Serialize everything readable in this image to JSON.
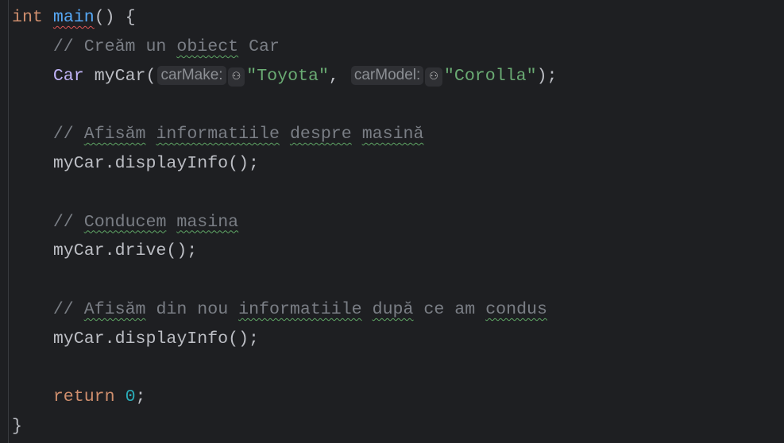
{
  "editor": {
    "lines": [
      [
        {
          "t": "int",
          "c": "kw"
        },
        {
          "t": " "
        },
        {
          "t": "main",
          "c": "fn err"
        },
        {
          "t": "() {"
        }
      ],
      [
        {
          "t": "    "
        },
        {
          "t": "// Creăm un ",
          "c": "cmt"
        },
        {
          "t": "obiect",
          "c": "cmt typo"
        },
        {
          "t": " Car",
          "c": "cmt"
        }
      ],
      [
        {
          "t": "    "
        },
        {
          "t": "Car",
          "c": "cls"
        },
        {
          "t": " myCar("
        },
        {
          "t": "carMake:",
          "c": "hint"
        },
        {
          "t": "⚇",
          "c": "hint-icon"
        },
        {
          "t": "\"Toyota\"",
          "c": "str"
        },
        {
          "t": ", "
        },
        {
          "t": "carModel:",
          "c": "hint"
        },
        {
          "t": "⚇",
          "c": "hint-icon"
        },
        {
          "t": "\"Corolla\"",
          "c": "str"
        },
        {
          "t": ");"
        }
      ],
      [
        {
          "t": ""
        }
      ],
      [
        {
          "t": "    "
        },
        {
          "t": "// ",
          "c": "cmt"
        },
        {
          "t": "Afisăm",
          "c": "cmt typo"
        },
        {
          "t": " ",
          "c": "cmt"
        },
        {
          "t": "informatiile",
          "c": "cmt typo"
        },
        {
          "t": " ",
          "c": "cmt"
        },
        {
          "t": "despre",
          "c": "cmt typo"
        },
        {
          "t": " ",
          "c": "cmt"
        },
        {
          "t": "masină",
          "c": "cmt typo"
        }
      ],
      [
        {
          "t": "    myCar.displayInfo();"
        }
      ],
      [
        {
          "t": ""
        }
      ],
      [
        {
          "t": "    "
        },
        {
          "t": "// ",
          "c": "cmt"
        },
        {
          "t": "Conducem",
          "c": "cmt typo"
        },
        {
          "t": " ",
          "c": "cmt"
        },
        {
          "t": "masina",
          "c": "cmt typo"
        }
      ],
      [
        {
          "t": "    myCar.drive();"
        }
      ],
      [
        {
          "t": ""
        }
      ],
      [
        {
          "t": "    "
        },
        {
          "t": "// ",
          "c": "cmt"
        },
        {
          "t": "Afisăm",
          "c": "cmt typo"
        },
        {
          "t": " din nou ",
          "c": "cmt"
        },
        {
          "t": "informatiile",
          "c": "cmt typo"
        },
        {
          "t": " ",
          "c": "cmt"
        },
        {
          "t": "după",
          "c": "cmt typo"
        },
        {
          "t": " ce am ",
          "c": "cmt"
        },
        {
          "t": "condus",
          "c": "cmt typo"
        }
      ],
      [
        {
          "t": "    myCar.displayInfo();"
        }
      ],
      [
        {
          "t": ""
        }
      ],
      [
        {
          "t": "    "
        },
        {
          "t": "return",
          "c": "kw"
        },
        {
          "t": " "
        },
        {
          "t": "0",
          "c": "num"
        },
        {
          "t": ";"
        }
      ],
      [
        {
          "t": "}"
        }
      ]
    ],
    "colors": {
      "background": "#1e1f22",
      "keyword": "#cf8e6d",
      "function": "#56a8f5",
      "string": "#6aab73",
      "number": "#2aacb8",
      "comment": "#7a7e85"
    }
  }
}
